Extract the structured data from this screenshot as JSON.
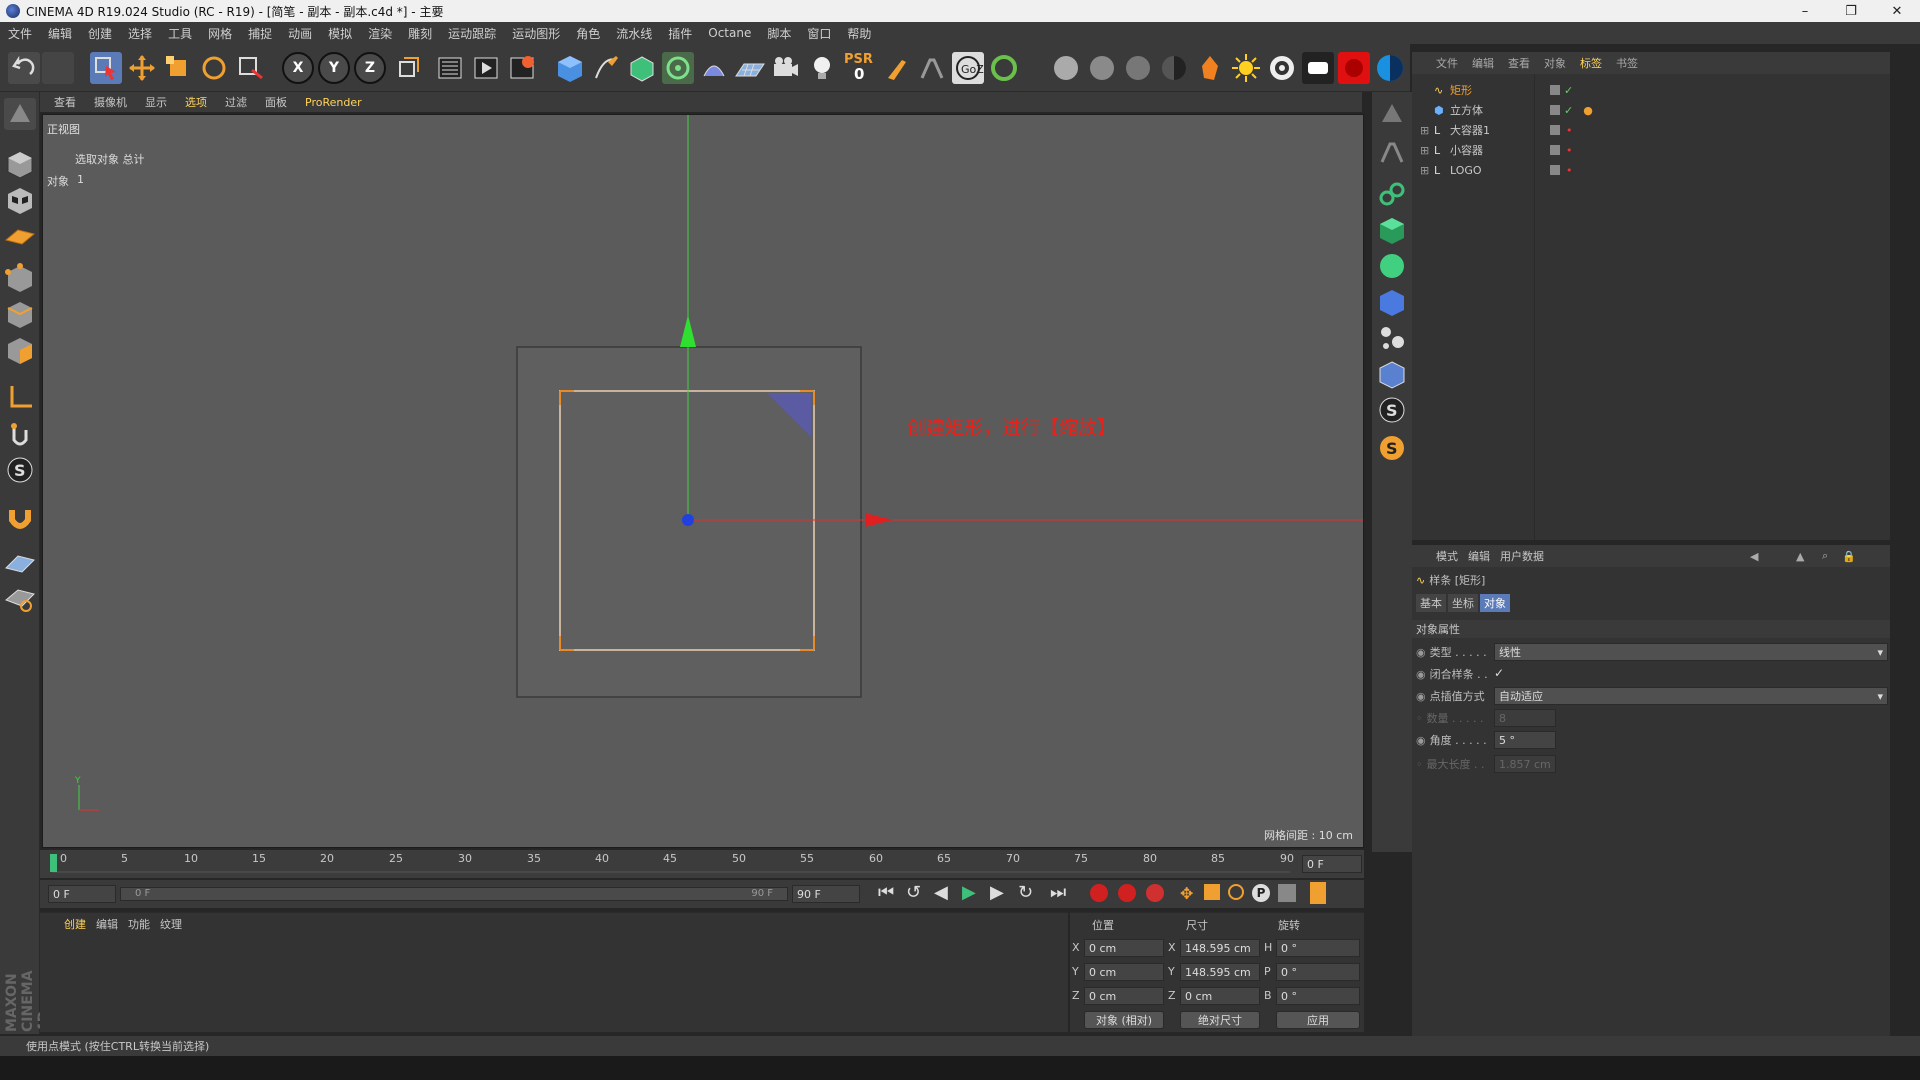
{
  "window": {
    "title": "CINEMA 4D R19.024 Studio (RC - R19) - [简笔 - 副本 - 副本.c4d *] - 主要",
    "minimize": "–",
    "restore": "❐",
    "close": "✕"
  },
  "menubar": {
    "items": [
      "文件",
      "编辑",
      "创建",
      "选择",
      "工具",
      "网格",
      "捕捉",
      "动画",
      "模拟",
      "渲染",
      "雕刻",
      "运动跟踪",
      "运动图形",
      "角色",
      "流水线",
      "插件",
      "Octane",
      "脚本",
      "窗口",
      "帮助"
    ]
  },
  "toolbar": {
    "axis_x": "X",
    "axis_y": "Y",
    "axis_z": "Z",
    "psr_label": "PSR",
    "psr_value": "0"
  },
  "viewport": {
    "menu": [
      "查看",
      "摄像机",
      "显示",
      "选项",
      "过滤",
      "面板",
      "ProRender"
    ],
    "view_name": "正视图",
    "hud_selection_label": "选取对象 总计",
    "hud_object_label": "对象",
    "hud_object_count": "1",
    "grid_spacing": "网格间距 : 10 cm",
    "annotation": "创建矩形，进行【缩放】",
    "annotation_color": "#e8221b"
  },
  "object_manager": {
    "menu": [
      "文件",
      "编辑",
      "查看",
      "对象",
      "标签",
      "书签"
    ],
    "objects": [
      {
        "name": "矩形",
        "selected": true
      },
      {
        "name": "立方体",
        "selected": false
      },
      {
        "name": "大容器1",
        "selected": false
      },
      {
        "name": "小容器",
        "selected": false
      },
      {
        "name": "LOGO",
        "selected": false
      }
    ]
  },
  "attribute_manager": {
    "menu": [
      "模式",
      "编辑",
      "用户数据"
    ],
    "object_title": "样条 [矩形]",
    "tabs": [
      "基本",
      "坐标",
      "对象"
    ],
    "active_tab": "对象",
    "section": "对象属性",
    "rows": {
      "type_label": "类型 . . . . .",
      "type_value": "线性",
      "closed_label": "闭合样条 . .",
      "closed_value": "✓",
      "interp_label": "点插值方式",
      "interp_value": "自动适应",
      "count_label": "数量 . . . . .",
      "count_value": "8",
      "angle_label": "角度 . . . . .",
      "angle_value": "5 °",
      "maxlen_label": "最大长度 . .",
      "maxlen_value": "1.857 cm"
    }
  },
  "timeline": {
    "ticks": [
      "0",
      "5",
      "10",
      "15",
      "20",
      "25",
      "30",
      "35",
      "40",
      "45",
      "50",
      "55",
      "60",
      "65",
      "70",
      "75",
      "80",
      "85",
      "90"
    ],
    "current_frame": "0 F",
    "start_frame": "0 F",
    "range_start": "0 F",
    "range_end": "90 F",
    "end_frame": "90 F"
  },
  "material_manager": {
    "menu": [
      "创建",
      "编辑",
      "功能",
      "纹理"
    ]
  },
  "coordinates": {
    "col_position": "位置",
    "col_size": "尺寸",
    "col_rotation": "旋转",
    "pos_x": "0 cm",
    "pos_y": "0 cm",
    "pos_z": "0 cm",
    "size_x": "148.595 cm",
    "size_y": "148.595 cm",
    "size_z": "0 cm",
    "rot_h": "0 °",
    "rot_p": "0 °",
    "rot_b": "0 °",
    "mode_object": "对象 (相对)",
    "mode_size": "绝对尺寸",
    "apply": "应用"
  },
  "statusbar": {
    "text": "使用点模式 (按住CTRL转换当前选择)"
  },
  "brand": "MAXON CINEMA 4D"
}
